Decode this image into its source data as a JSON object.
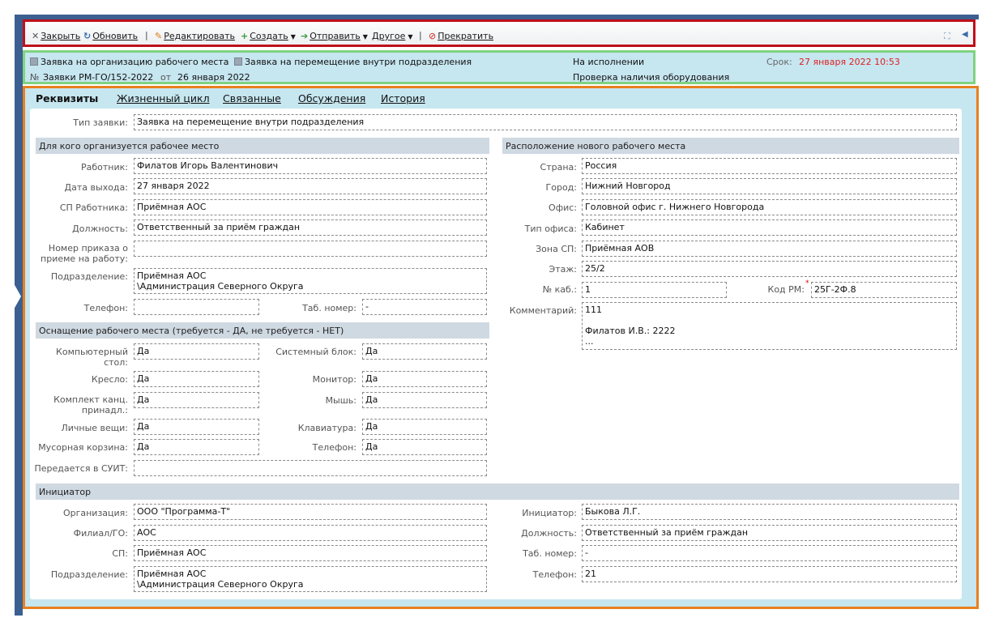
{
  "toolbar": {
    "close": "Закрыть",
    "refresh": "Обновить",
    "edit": "Редактировать",
    "create": "Создать",
    "send": "Отправить",
    "other": "Другое",
    "stop": "Прекратить"
  },
  "info": {
    "type1": "Заявка на организацию рабочего места",
    "type2": "Заявка на перемещение внутри подразделения",
    "num_prefix": "№",
    "number": "Заявки РМ-ГО/152-2022",
    "from": "от",
    "date": "26 января 2022",
    "status": "На исполнении",
    "stage": "Проверка наличия оборудования",
    "deadline_label": "Срок:",
    "deadline": "27 января 2022 10:53",
    "deadline_color": "#e02020"
  },
  "tabs": [
    "Реквизиты",
    "Жизненный цикл",
    "Связанные",
    "Обсуждения",
    "История"
  ],
  "form": {
    "request_type_label": "Тип заявки:",
    "request_type": "Заявка на перемещение внутри подразделения",
    "sec_for_whom": "Для кого организуется рабочее место",
    "employee_label": "Работник:",
    "employee": "Филатов Игорь Валентинович",
    "start_date_label": "Дата выхода:",
    "start_date": "27 января 2022",
    "emp_dept_label": "СП Работника:",
    "emp_dept": "Приёмная АОС",
    "position_label": "Должность:",
    "position": "Ответственный за приём граждан",
    "order_label": "Номер приказа о приеме на работу:",
    "order": "",
    "division_label": "Подразделение:",
    "division": "Приёмная АОС\n\\Администрация Северного Округа",
    "phone_label": "Телефон:",
    "phone": "",
    "tab_num_label": "Таб. номер:",
    "tab_num": "-",
    "sec_equipment": "Оснащение рабочего места (требуется - ДА, не требуется - НЕТ)",
    "desk_label": "Компьютерный стол:",
    "desk": "Да",
    "sysunit_label": "Системный блок:",
    "sysunit": "Да",
    "chair_label": "Кресло:",
    "chair": "Да",
    "monitor_label": "Монитор:",
    "monitor": "Да",
    "stationery_label": "Комплект канц. принадл.:",
    "stationery": "Да",
    "mouse_label": "Мышь:",
    "mouse": "Да",
    "personal_label": "Личные вещи:",
    "personal": "Да",
    "keyboard_label": "Клавиатура:",
    "keyboard": "Да",
    "trash_label": "Мусорная корзина:",
    "trash": "Да",
    "eq_phone_label": "Телефон:",
    "eq_phone": "Да",
    "suit_label": "Передается в СУИТ:",
    "suit": "",
    "sec_location": "Расположение нового рабочего места",
    "country_label": "Страна:",
    "country": "Россия",
    "city_label": "Город:",
    "city": "Нижний Новгород",
    "office_label": "Офис:",
    "office": "Головной офис г. Нижнего Новгорода",
    "office_type_label": "Тип офиса:",
    "office_type": "Кабинет",
    "zone_label": "Зона СП:",
    "zone": "Приёмная АОВ",
    "floor_label": "Этаж:",
    "floor": "25/2",
    "room_label": "№ каб.:",
    "room": "1",
    "rm_code_label": "Код РМ:",
    "rm_code": "25Г-2Ф.8",
    "comment_label": "Комментарий:",
    "comment": "111\n\nФилатов И.В.: 2222\n...",
    "sec_initiator": "Инициатор",
    "org_label": "Организация:",
    "org": "ООО \"Программа-Т\"",
    "branch_label": "Филиал/ГО:",
    "branch": "АОС",
    "sp_label": "СП:",
    "sp": "Приёмная АОС",
    "init_div_label": "Подразделение:",
    "init_div": "Приёмная АОС\n\\Администрация Северного Округа",
    "initiator_label": "Инициатор:",
    "initiator": "Быкова Л.Г.",
    "init_pos_label": "Должность:",
    "init_pos": "Ответственный за приём граждан",
    "init_tab_label": "Таб. номер:",
    "init_tab": "-",
    "init_phone_label": "Телефон:",
    "init_phone": "21"
  }
}
